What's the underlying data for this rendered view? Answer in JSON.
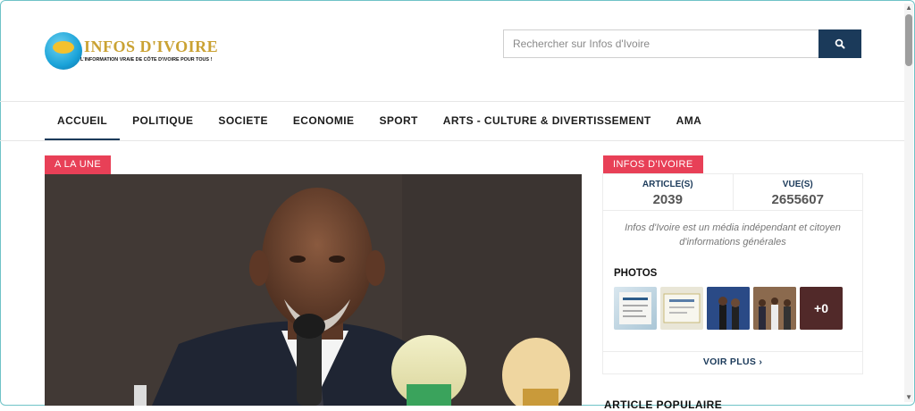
{
  "site": {
    "logo_title": "INFOS D'IVOIRE",
    "logo_tagline": "L'INFORMATION VRAIE DE CÔTE D'IVOIRE POUR TOUS !"
  },
  "search": {
    "placeholder": "Rechercher sur Infos d'Ivoire",
    "button_icon": "search-icon"
  },
  "nav": {
    "items": [
      {
        "label": "ACCUEIL",
        "active": true
      },
      {
        "label": "POLITIQUE"
      },
      {
        "label": "SOCIETE"
      },
      {
        "label": "ECONOMIE"
      },
      {
        "label": "SPORT"
      },
      {
        "label": "ARTS - CULTURE & DIVERTISSEMENT"
      },
      {
        "label": "AMA"
      }
    ]
  },
  "main": {
    "headline_badge": "A LA UNE"
  },
  "sidebar": {
    "badge": "INFOS D'IVOIRE",
    "stats": [
      {
        "label": "ARTICLE(S)",
        "value": "2039"
      },
      {
        "label": "VUE(S)",
        "value": "2655607"
      }
    ],
    "about": "Infos d'Ivoire est un média indépendant et citoyen d'informations générales",
    "photos_title": "PHOTOS",
    "photos_more_overlay": "+0",
    "more_link": "VOIR PLUS",
    "popular_title": "ARTICLE POPULAIRE"
  },
  "colors": {
    "accent_red": "#e84057",
    "navy": "#1b3a5a",
    "logo_gold": "#caa233"
  }
}
